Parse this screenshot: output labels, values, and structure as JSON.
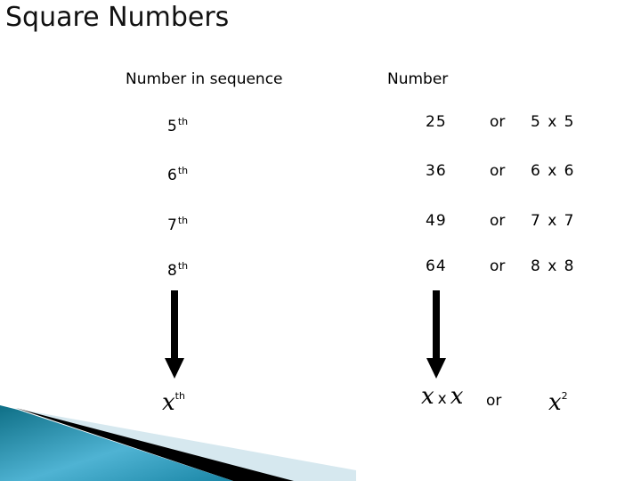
{
  "title": "Square Numbers",
  "headers": {
    "sequence": "Number in sequence",
    "number": "Number"
  },
  "rows": [
    {
      "ordinal": "5",
      "suffix": "th",
      "value": "25",
      "or": "or",
      "product": "5 x 5"
    },
    {
      "ordinal": "6",
      "suffix": "th",
      "value": "36",
      "or": "or",
      "product": "6 x 6"
    },
    {
      "ordinal": "7",
      "suffix": "th",
      "value": "49",
      "or": "or",
      "product": "7 x 7"
    },
    {
      "ordinal": "8",
      "suffix": "th",
      "value": "64",
      "or": "or",
      "product": "8 x 8"
    }
  ],
  "general": {
    "variable": "x",
    "suffix": "th",
    "times": "x",
    "or": "or",
    "exponent": "2"
  },
  "colors": {
    "teal_dark": "#0e6f86",
    "teal_light": "#4fb3d3",
    "stripe": "#000000",
    "band": "#d6e8ef"
  }
}
